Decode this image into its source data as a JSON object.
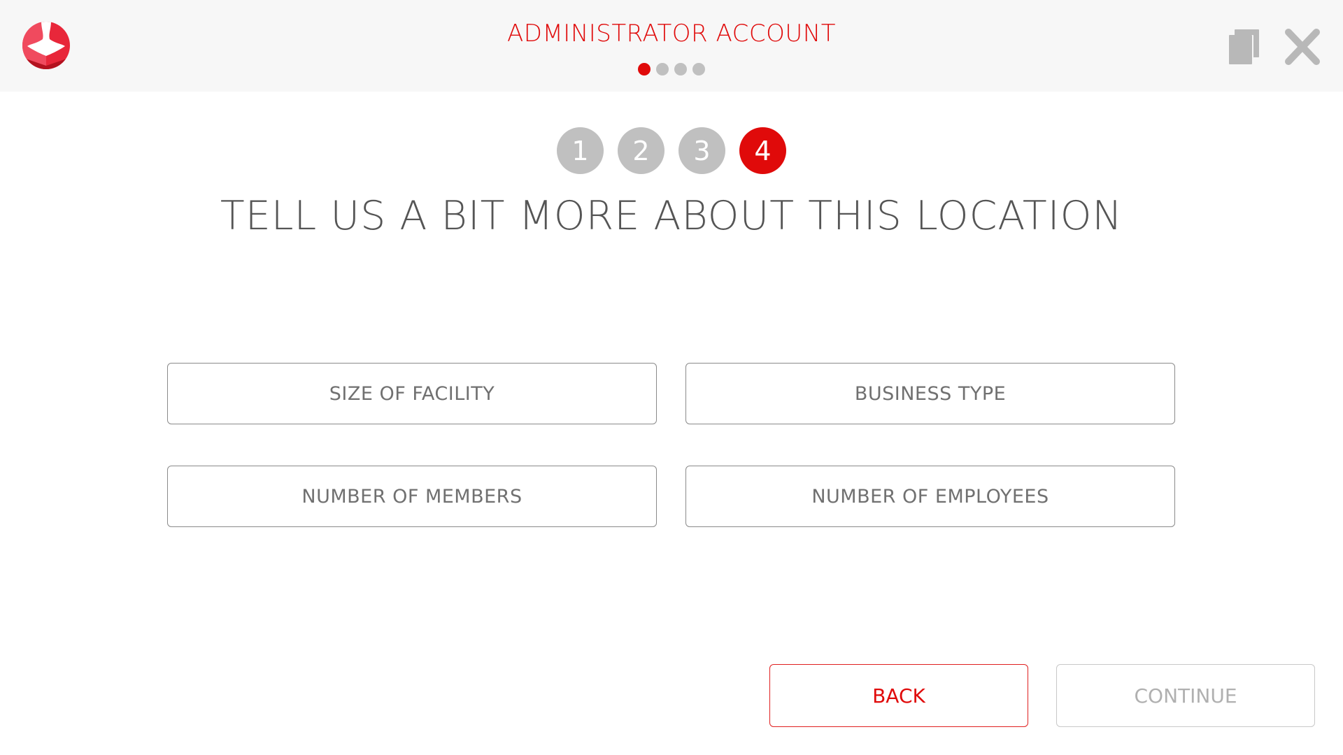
{
  "header": {
    "title": "ADMINISTRATOR ACCOUNT",
    "logo_icon": "profile-badge-logo-icon",
    "copy_icon": "copy-icon",
    "close_icon": "close-icon",
    "page_dots": {
      "total": 4,
      "active_index": 0
    }
  },
  "steps": {
    "items": [
      {
        "label": "1",
        "state": "inactive"
      },
      {
        "label": "2",
        "state": "inactive"
      },
      {
        "label": "3",
        "state": "inactive"
      },
      {
        "label": "4",
        "state": "active"
      }
    ]
  },
  "main": {
    "heading": "TELL US A BIT MORE ABOUT THIS LOCATION",
    "fields": [
      {
        "label": "SIZE OF FACILITY"
      },
      {
        "label": "BUSINESS TYPE"
      },
      {
        "label": "NUMBER OF MEMBERS"
      },
      {
        "label": "NUMBER OF EMPLOYEES"
      }
    ]
  },
  "footer": {
    "back_label": "BACK",
    "continue_label": "CONTINUE",
    "continue_enabled": false
  },
  "colors": {
    "accent": "#e00a0a",
    "inactive": "#c0c0c0",
    "header_bg": "#f7f7f7",
    "text": "#555555"
  }
}
